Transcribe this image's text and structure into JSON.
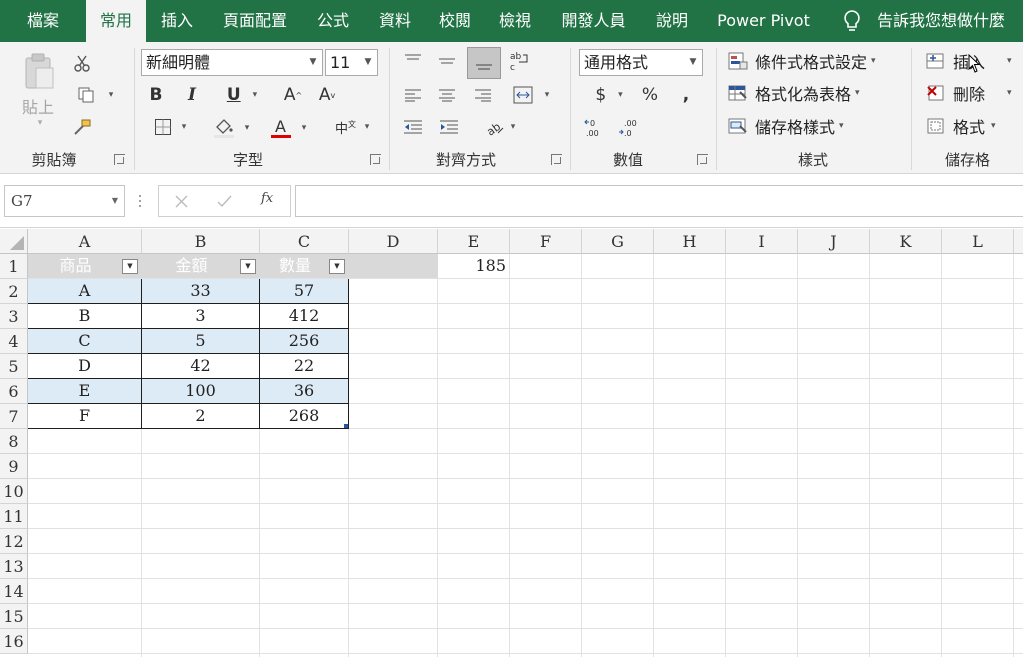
{
  "tabs": [
    {
      "label": "檔案",
      "active": false
    },
    {
      "label": "常用",
      "active": true
    },
    {
      "label": "插入",
      "active": false
    },
    {
      "label": "頁面配置",
      "active": false
    },
    {
      "label": "公式",
      "active": false
    },
    {
      "label": "資料",
      "active": false
    },
    {
      "label": "校閱",
      "active": false
    },
    {
      "label": "檢視",
      "active": false
    },
    {
      "label": "開發人員",
      "active": false
    },
    {
      "label": "說明",
      "active": false
    },
    {
      "label": "Power Pivot",
      "active": false
    }
  ],
  "tell_me": "告訴我您想做什麼",
  "ribbon": {
    "clipboard": {
      "label": "剪貼簿",
      "paste_label": "貼上"
    },
    "font": {
      "label": "字型",
      "font_name": "新細明體",
      "font_size": "11"
    },
    "alignment": {
      "label": "對齊方式"
    },
    "number": {
      "label": "數值",
      "format": "通用格式",
      "currency": "$",
      "percent": "%",
      "comma": ","
    },
    "styles": {
      "label": "樣式",
      "conditional_formatting": "條件式格式設定",
      "format_as_table": "格式化為表格",
      "cell_styles": "儲存格樣式"
    },
    "cells": {
      "label": "儲存格",
      "insert": "插入",
      "delete": "刪除",
      "format": "格式"
    }
  },
  "formula_bar": {
    "name_box": "G7",
    "fx": "fx",
    "formula": ""
  },
  "columns": [
    "A",
    "B",
    "C",
    "D",
    "E",
    "F",
    "G",
    "H",
    "I",
    "J",
    "K",
    "L"
  ],
  "rows": [
    "1",
    "2",
    "3",
    "4",
    "5",
    "6",
    "7",
    "8",
    "9",
    "10",
    "11",
    "12",
    "13",
    "14",
    "15",
    "16"
  ],
  "table": {
    "headers": [
      "商品",
      "金額",
      "數量"
    ],
    "rows": [
      [
        "A",
        "33",
        "57"
      ],
      [
        "B",
        "3",
        "412"
      ],
      [
        "C",
        "5",
        "256"
      ],
      [
        "D",
        "42",
        "22"
      ],
      [
        "E",
        "100",
        "36"
      ],
      [
        "F",
        "2",
        "268"
      ]
    ]
  },
  "cells": {
    "E1": "185"
  },
  "colors": {
    "accent": "#217346",
    "band": "#ddebf7",
    "header_fill": "#d9d9d9"
  }
}
